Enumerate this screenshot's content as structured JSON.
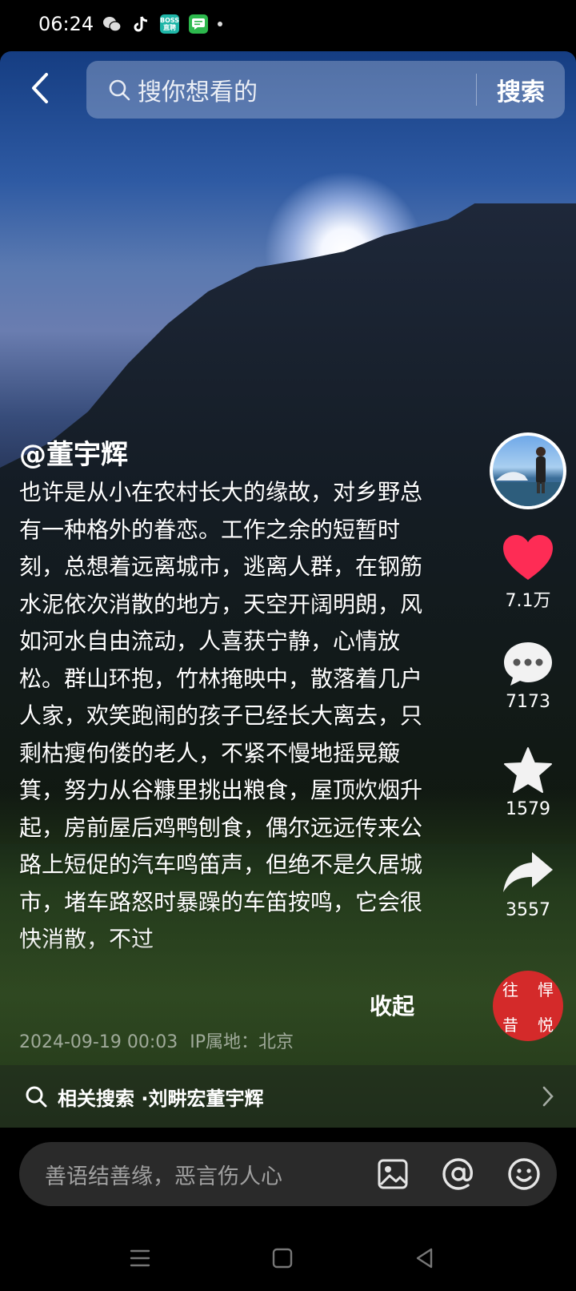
{
  "status_bar": {
    "time": "06:24",
    "icons": [
      "wechat-icon",
      "tiktok-icon",
      "boss-app-icon",
      "message-app-icon",
      "dot-icon"
    ],
    "boss_label": "BOSS\n直聘"
  },
  "header": {
    "search_placeholder": "搜你想看的",
    "search_button": "搜索"
  },
  "post": {
    "author": "@董宇辉",
    "description": "也许是从小在农村长大的缘故，对乡野总有一种格外的眷恋。工作之余的短暂时刻，总想着远离城市，逃离人群，在钢筋水泥依次消散的地方，天空开阔明朗，风如河水自由流动，人喜获宁静，心情放松。群山环抱，竹林掩映中，散落着几户人家，欢笑跑闹的孩子已经长大离去，只剩枯瘦佝偻的老人，不紧不慢地摇晃簸箕，努力从谷糠里挑出粮食，屋顶炊烟升起，房前屋后鸡鸭刨食，偶尔远远传来公路上短促的汽车鸣笛声，但绝不是久居城市，堵车路怒时暴躁的车笛按鸣，它会很快消散，不过",
    "collapse_label": "收起",
    "timestamp": "2024-09-19 00:03",
    "ip_location": "IP属地：北京"
  },
  "actions": {
    "likes": "7.1万",
    "comments": "7173",
    "favorites": "1579",
    "shares": "3557",
    "like_color": "#fe2c55",
    "music_disc_text": [
      "往",
      "悍",
      "昔",
      "悦"
    ]
  },
  "related_search": {
    "label": "相关搜索 ·",
    "term": " 刘畊宏董宇辉"
  },
  "comment_bar": {
    "placeholder": "善语结善缘，恶言伤人心"
  }
}
